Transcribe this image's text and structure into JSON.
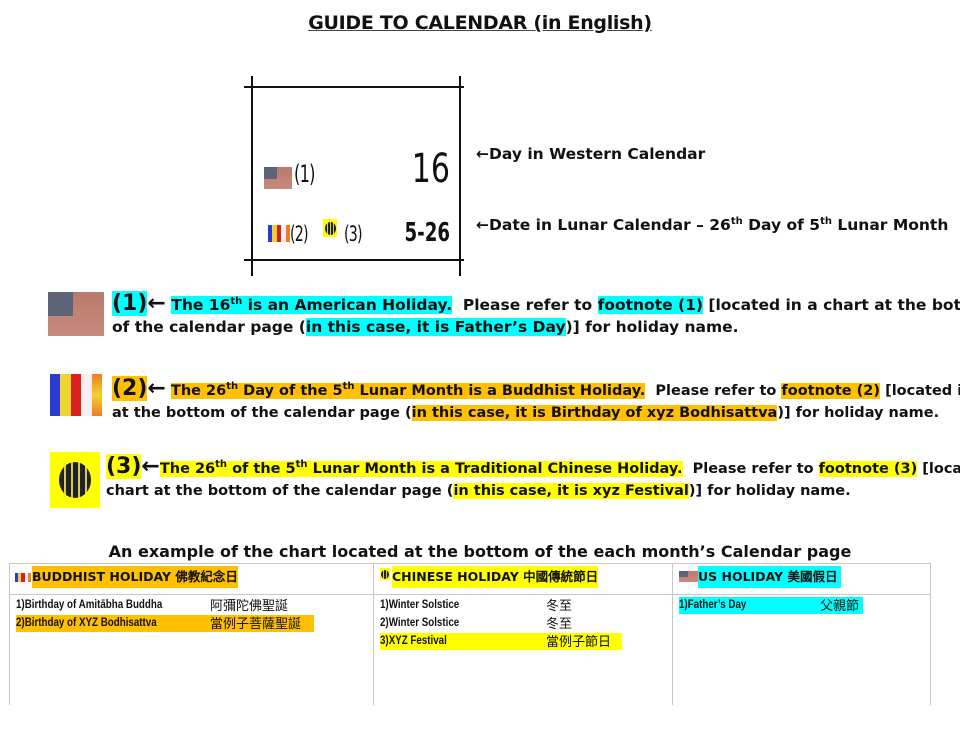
{
  "title": "GUIDE TO CALENDAR (in English)",
  "calendar_cell": {
    "marker_us": "(1)",
    "marker_buddhist": "(2)",
    "marker_chinese": "(3)",
    "western_day": "16",
    "lunar_date": "5-26"
  },
  "pointers": {
    "western": {
      "arrow": "←",
      "text": "Day in Western Calendar"
    },
    "lunar": {
      "arrow": "←",
      "pre": "Date in Lunar Calendar – 26",
      "sup1": "th",
      "mid": " Day of 5",
      "sup2": "th",
      "post": " Lunar Month"
    }
  },
  "explanations": [
    {
      "icon": "us-flag-icon",
      "number": "(1)",
      "arrow": "←",
      "highlight_color": "#00ffff",
      "lead_a": "The 16",
      "lead_sup": "th",
      "lead_b": " is an American Holiday.",
      "refer": "  Please refer to ",
      "footnote": "footnote (1)",
      "line1_tail": " [located in a chart at the bottom",
      "line2_head": "of the calendar page (",
      "example": "in this case, it is Father’s Day",
      "line2_tail": ")] for holiday name."
    },
    {
      "icon": "buddhist-flag-icon",
      "number": "(2)",
      "arrow": "←",
      "highlight_color": "#ffc000",
      "lead_a": "The 26",
      "lead_sup": "th",
      "lead_b": " Day of the 5",
      "lead_sup2": "th",
      "lead_c": " Lunar Month is a Buddhist Holiday.",
      "refer": "  Please refer to ",
      "footnote": "footnote (2)",
      "line1_tail": " [located in a chart",
      "line2_head": "at the bottom of the calendar page (",
      "example": "in this case, it is Birthday of xyz Bodhisattva",
      "line2_tail": ")] for holiday name."
    },
    {
      "icon": "dharma-wheel-icon",
      "number": "(3)",
      "arrow": "←",
      "highlight_color": "#ffff00",
      "lead_a": "The 26",
      "lead_sup": "th",
      "lead_b": " of the 5",
      "lead_sup2": "th",
      "lead_c": " Lunar Month is a Traditional Chinese Holiday.",
      "refer": "  Please refer to ",
      "footnote": "footnote (3)",
      "line1_tail": " [located in a",
      "line2_head": "chart at the bottom of the calendar page (",
      "example": "in this case, it is xyz Festival",
      "line2_tail": ")] for holiday name."
    }
  ],
  "chart_caption": "An example of the chart located at the bottom of the each month’s Calendar page",
  "holiday_chart": {
    "columns": [
      {
        "header": "BUDDHIST HOLIDAY 佛教紀念日",
        "icon": "buddhist-flag-icon",
        "color": "#ffc000",
        "rows": [
          {
            "en": "1)Birthday of Amitābha Buddha",
            "zh": "阿彌陀佛聖誕",
            "highlighted": false
          },
          {
            "en": "2)Birthday of XYZ Bodhisattva",
            "zh": "當例子菩薩聖誕",
            "highlighted": true
          }
        ]
      },
      {
        "header": "CHINESE HOLIDAY 中國傳統節日",
        "icon": "dharma-wheel-icon",
        "color": "#ffff00",
        "rows": [
          {
            "en": "1)Winter Solstice",
            "zh": "冬至",
            "highlighted": false
          },
          {
            "en": "2)Winter Solstice",
            "zh": "冬至",
            "highlighted": false
          },
          {
            "en": "3)XYZ Festival",
            "zh": "當例子節日",
            "highlighted": true
          }
        ]
      },
      {
        "header": "US HOLIDAY  美國假日",
        "icon": "us-flag-icon",
        "color": "#00ffff",
        "rows": [
          {
            "en": "1)Father’s Day",
            "zh": "父親節",
            "highlighted": true
          }
        ]
      }
    ]
  }
}
